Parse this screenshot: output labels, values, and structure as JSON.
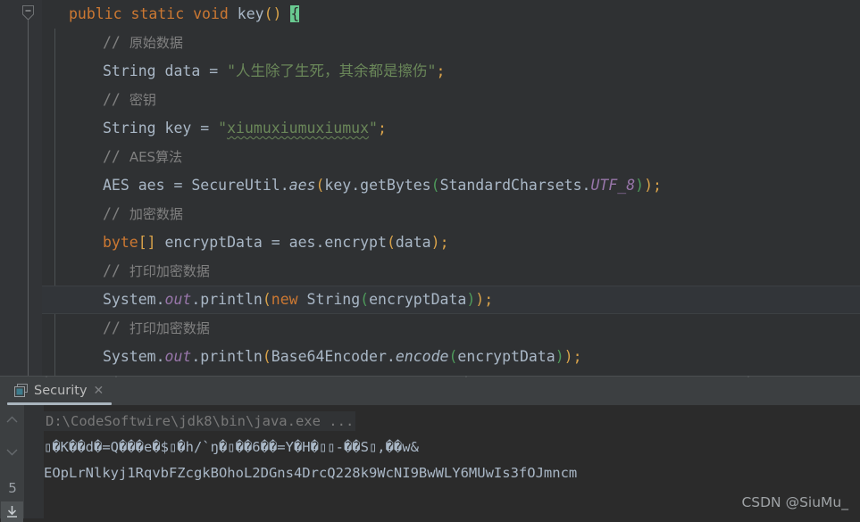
{
  "editor": {
    "fold_icon": "collapse-fold-icon",
    "lines": [
      {
        "id": "line-signature",
        "type": "code",
        "indent": 0,
        "current": false,
        "tokens": [
          {
            "t": "public",
            "c": "kw"
          },
          {
            "t": " ",
            "c": "plain"
          },
          {
            "t": "static",
            "c": "kw"
          },
          {
            "t": " ",
            "c": "plain"
          },
          {
            "t": "void",
            "c": "kw"
          },
          {
            "t": " ",
            "c": "plain"
          },
          {
            "t": "key",
            "c": "var"
          },
          {
            "t": "()",
            "c": "p-y"
          },
          {
            "t": " ",
            "c": "plain"
          },
          {
            "t": "{",
            "c": "brace-hl"
          }
        ],
        "text": "public static void key() {"
      },
      {
        "id": "line-comment-raw-data",
        "type": "comment",
        "indent": 1,
        "current": false,
        "tokens": [
          {
            "t": "// ",
            "c": "cmt"
          },
          {
            "t": "原始数据",
            "c": "cmt-cn"
          }
        ],
        "text": "// 原始数据"
      },
      {
        "id": "line-string-data",
        "type": "code",
        "indent": 1,
        "current": false,
        "tokens": [
          {
            "t": "String",
            "c": "cls"
          },
          {
            "t": " data ",
            "c": "plain"
          },
          {
            "t": "=",
            "c": "plain"
          },
          {
            "t": " ",
            "c": "plain"
          },
          {
            "t": "\"",
            "c": "str"
          },
          {
            "t": "人生除了生死，其余都是擦伤",
            "c": "str-cn"
          },
          {
            "t": "\"",
            "c": "str"
          },
          {
            "t": ";",
            "c": "p-y"
          }
        ],
        "text": "String data = \"人生除了生死，其余都是擦伤\";"
      },
      {
        "id": "line-comment-key",
        "type": "comment",
        "indent": 1,
        "current": false,
        "tokens": [
          {
            "t": "// ",
            "c": "cmt"
          },
          {
            "t": "密钥",
            "c": "cmt-cn"
          }
        ],
        "text": "// 密钥"
      },
      {
        "id": "line-string-key",
        "type": "code",
        "indent": 1,
        "current": false,
        "tokens": [
          {
            "t": "String",
            "c": "cls"
          },
          {
            "t": " key ",
            "c": "plain"
          },
          {
            "t": "=",
            "c": "plain"
          },
          {
            "t": " ",
            "c": "plain"
          },
          {
            "t": "\"",
            "c": "str"
          },
          {
            "t": "xiumuxiumuxiumux",
            "c": "str squiggle"
          },
          {
            "t": "\"",
            "c": "str"
          },
          {
            "t": ";",
            "c": "p-y"
          }
        ],
        "text": "String key = \"xiumuxiumuxiumux\";"
      },
      {
        "id": "line-comment-aes",
        "type": "comment",
        "indent": 1,
        "current": false,
        "tokens": [
          {
            "t": "// ",
            "c": "cmt"
          },
          {
            "t": "AES算法",
            "c": "cmt-cn"
          }
        ],
        "text": "// AES算法"
      },
      {
        "id": "line-aes-init",
        "type": "code",
        "indent": 1,
        "current": false,
        "tokens": [
          {
            "t": "AES",
            "c": "cls"
          },
          {
            "t": " aes ",
            "c": "plain"
          },
          {
            "t": "=",
            "c": "plain"
          },
          {
            "t": " ",
            "c": "plain"
          },
          {
            "t": "SecureUtil",
            "c": "cls"
          },
          {
            "t": ".",
            "c": "plain"
          },
          {
            "t": "aes",
            "c": "mth"
          },
          {
            "t": "(",
            "c": "p-y"
          },
          {
            "t": "key",
            "c": "plain"
          },
          {
            "t": ".",
            "c": "plain"
          },
          {
            "t": "getBytes",
            "c": "plain"
          },
          {
            "t": "(",
            "c": "p-g"
          },
          {
            "t": "StandardCharsets",
            "c": "cls"
          },
          {
            "t": ".",
            "c": "plain"
          },
          {
            "t": "UTF_8",
            "c": "stat"
          },
          {
            "t": ")",
            "c": "p-g"
          },
          {
            "t": ")",
            "c": "p-y"
          },
          {
            "t": ";",
            "c": "p-y"
          }
        ],
        "text": "AES aes = SecureUtil.aes(key.getBytes(StandardCharsets.UTF_8));"
      },
      {
        "id": "line-comment-encrypt",
        "type": "comment",
        "indent": 1,
        "current": false,
        "tokens": [
          {
            "t": "// ",
            "c": "cmt"
          },
          {
            "t": "加密数据",
            "c": "cmt-cn"
          }
        ],
        "text": "// 加密数据"
      },
      {
        "id": "line-encrypt-data",
        "type": "code",
        "indent": 1,
        "current": false,
        "tokens": [
          {
            "t": "byte",
            "c": "kw"
          },
          {
            "t": "[]",
            "c": "p-y"
          },
          {
            "t": " encryptData ",
            "c": "plain"
          },
          {
            "t": "=",
            "c": "plain"
          },
          {
            "t": " ",
            "c": "plain"
          },
          {
            "t": "aes",
            "c": "plain"
          },
          {
            "t": ".",
            "c": "plain"
          },
          {
            "t": "encrypt",
            "c": "plain"
          },
          {
            "t": "(",
            "c": "p-y"
          },
          {
            "t": "data",
            "c": "plain"
          },
          {
            "t": ")",
            "c": "p-y"
          },
          {
            "t": ";",
            "c": "p-y"
          }
        ],
        "text": "byte[] encryptData = aes.encrypt(data);"
      },
      {
        "id": "line-comment-print-1",
        "type": "comment",
        "indent": 1,
        "current": false,
        "tokens": [
          {
            "t": "// ",
            "c": "cmt"
          },
          {
            "t": "打印加密数据",
            "c": "cmt-cn"
          }
        ],
        "text": "// 打印加密数据"
      },
      {
        "id": "line-print-string",
        "type": "code",
        "indent": 1,
        "current": true,
        "tokens": [
          {
            "t": "System",
            "c": "cls"
          },
          {
            "t": ".",
            "c": "plain"
          },
          {
            "t": "out",
            "c": "stat"
          },
          {
            "t": ".",
            "c": "plain"
          },
          {
            "t": "println",
            "c": "plain"
          },
          {
            "t": "(",
            "c": "p-y"
          },
          {
            "t": "new",
            "c": "kw"
          },
          {
            "t": " ",
            "c": "plain"
          },
          {
            "t": "String",
            "c": "cls"
          },
          {
            "t": "(",
            "c": "p-g"
          },
          {
            "t": "encryptData",
            "c": "plain"
          },
          {
            "t": ")",
            "c": "p-g"
          },
          {
            "t": ")",
            "c": "p-y"
          },
          {
            "t": ";",
            "c": "p-y"
          }
        ],
        "text": "System.out.println(new String(encryptData));"
      },
      {
        "id": "line-comment-print-2",
        "type": "comment",
        "indent": 1,
        "current": false,
        "tokens": [
          {
            "t": "// ",
            "c": "cmt"
          },
          {
            "t": "打印加密数据",
            "c": "cmt-cn"
          }
        ],
        "text": "// 打印加密数据"
      },
      {
        "id": "line-print-base64",
        "type": "code",
        "indent": 1,
        "current": false,
        "tokens": [
          {
            "t": "System",
            "c": "cls"
          },
          {
            "t": ".",
            "c": "plain"
          },
          {
            "t": "out",
            "c": "stat"
          },
          {
            "t": ".",
            "c": "plain"
          },
          {
            "t": "println",
            "c": "plain"
          },
          {
            "t": "(",
            "c": "p-y"
          },
          {
            "t": "Base64Encoder",
            "c": "cls"
          },
          {
            "t": ".",
            "c": "plain"
          },
          {
            "t": "encode",
            "c": "mth"
          },
          {
            "t": "(",
            "c": "p-g"
          },
          {
            "t": "encryptData",
            "c": "plain"
          },
          {
            "t": ")",
            "c": "p-g"
          },
          {
            "t": ")",
            "c": "p-y"
          },
          {
            "t": ";",
            "c": "p-y"
          }
        ],
        "text": "System.out.println(Base64Encoder.encode(encryptData));"
      }
    ]
  },
  "console": {
    "tab": {
      "label": "Security",
      "icon": "console-window-icon",
      "close_icon": "close-icon"
    },
    "toolbar": {
      "up_icon": "chevron-up-icon",
      "down_icon": "chevron-down-icon",
      "count": "5",
      "soft_wrap_icon": "download-arrow-icon"
    },
    "output": [
      {
        "id": "console-line-command",
        "kind": "command",
        "text": "D:\\CodeSoftwire\\jdk8\\bin\\java.exe ..."
      },
      {
        "id": "console-line-garbled",
        "kind": "stdout",
        "text": "▯�K��d�=Q���e�$▯�h/`ŋ�▯��6��=Y�H�▯▯-��S▯,��w&"
      },
      {
        "id": "console-line-base64",
        "kind": "stdout",
        "text": "EOpLrNlkyj1RqvbFZcgkBOhoL2DGns4DrcQ228k9WcNI9BwWLY6MUwIs3fOJmncm"
      }
    ]
  },
  "watermark": {
    "text": "CSDN @SiuMu_"
  },
  "colors": {
    "editor_bg": "#2f3133",
    "gutter_bg": "#323437",
    "panel_bg": "#3c3f41",
    "console_bg": "#2b2b2b",
    "keyword": "#cc7832",
    "string": "#6a8759",
    "comment": "#808080",
    "static_field": "#9876aa",
    "default_text": "#a9b7c6",
    "brace_match": "#69ca91"
  }
}
